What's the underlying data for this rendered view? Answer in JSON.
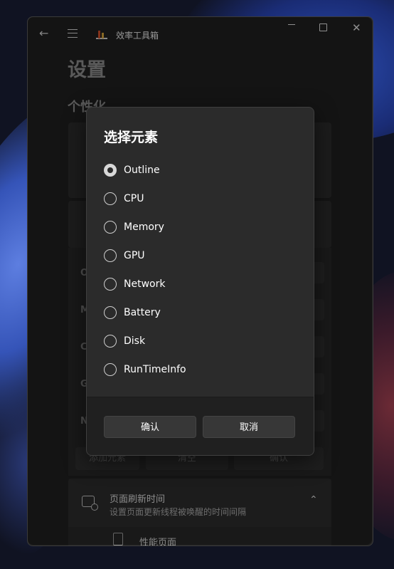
{
  "window": {
    "app_title": "效率工具箱",
    "back_icon": "back-arrow-icon",
    "menu_icon": "hamburger-menu-icon"
  },
  "page": {
    "title": "设置",
    "section": "个性化",
    "rows": [
      "O",
      "M",
      "C",
      "G",
      "N"
    ],
    "actions": {
      "add": "添加元素",
      "clear": "清空",
      "confirm": "确认"
    },
    "refresh": {
      "title": "页面刷新时间",
      "subtitle": "设置页面更新线程被唤醒的时间间隔"
    },
    "perf_label": "性能页面"
  },
  "dialog": {
    "title": "选择元素",
    "options": [
      "Outline",
      "CPU",
      "Memory",
      "GPU",
      "Network",
      "Battery",
      "Disk",
      "RunTimeInfo"
    ],
    "selected": "Outline",
    "ok_label": "确认",
    "cancel_label": "取消"
  },
  "colors": {
    "accent": "#d8d8d8",
    "dialog_bg": "#2b2b2b",
    "window_bg": "#202020"
  }
}
